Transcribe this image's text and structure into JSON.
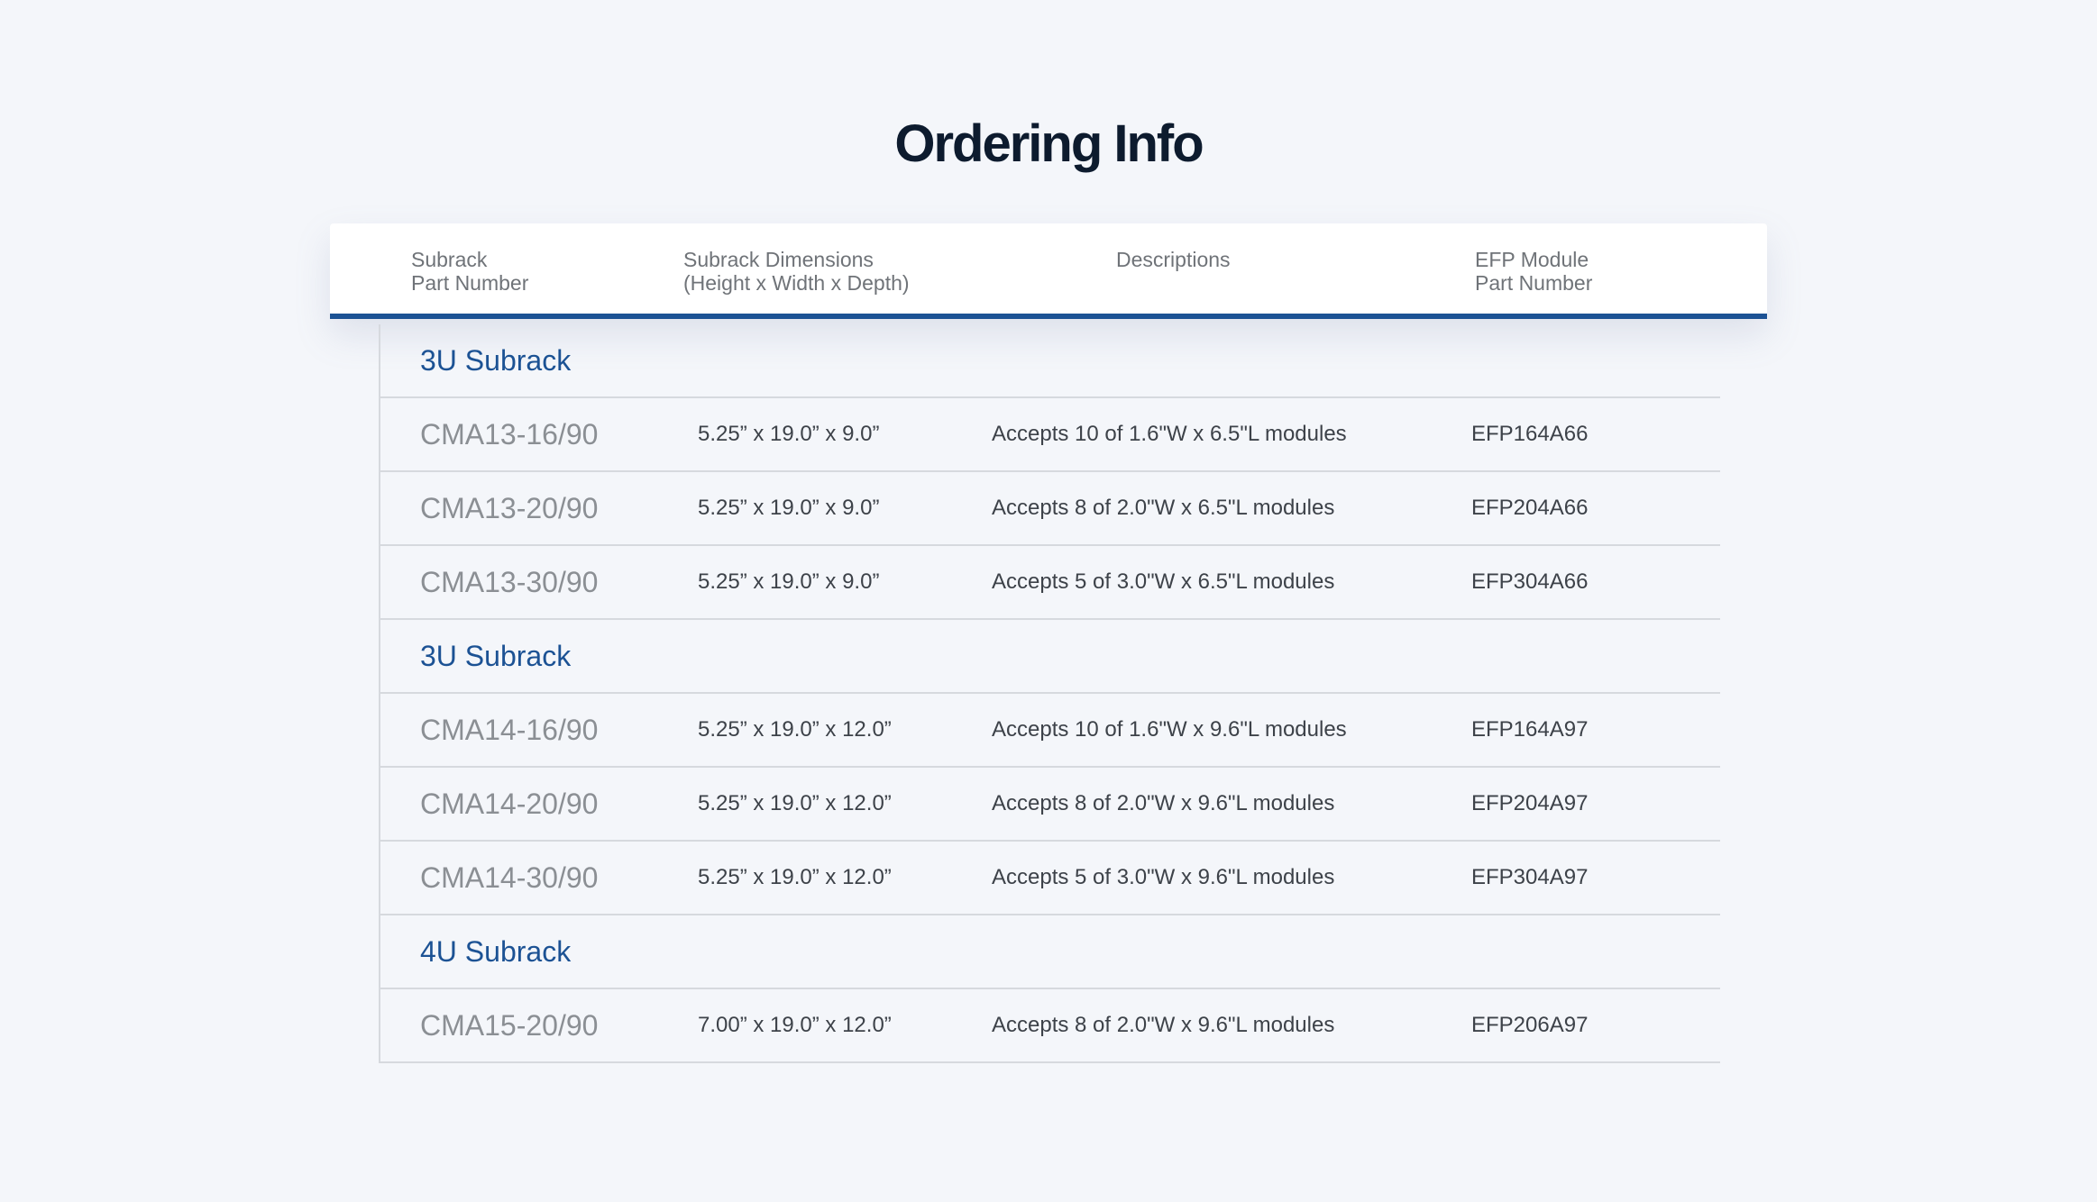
{
  "page": {
    "title": "Ordering Info"
  },
  "table": {
    "headers": {
      "part_line1": "Subrack",
      "part_line2": "Part Number",
      "dim_line1": "Subrack Dimensions",
      "dim_line2": "(Height x Width x Depth)",
      "desc": "Descriptions",
      "efp_line1": "EFP Module",
      "efp_line2": "Part Number"
    },
    "rows": [
      {
        "type": "group",
        "label": "3U Subrack"
      },
      {
        "type": "data",
        "part": "CMA13-16/90",
        "dim": "5.25” x 19.0” x 9.0”",
        "desc": "Accepts 10 of 1.6\"W x 6.5\"L modules",
        "efp": "EFP164A66"
      },
      {
        "type": "data",
        "part": "CMA13-20/90",
        "dim": "5.25” x 19.0” x 9.0”",
        "desc": "Accepts 8 of 2.0\"W x 6.5\"L modules",
        "efp": "EFP204A66"
      },
      {
        "type": "data",
        "part": "CMA13-30/90",
        "dim": "5.25” x 19.0” x 9.0”",
        "desc": "Accepts 5 of 3.0\"W x 6.5\"L modules",
        "efp": "EFP304A66"
      },
      {
        "type": "group",
        "label": "3U Subrack"
      },
      {
        "type": "data",
        "part": "CMA14-16/90",
        "dim": "5.25” x 19.0” x 12.0”",
        "desc": "Accepts 10 of 1.6\"W x 9.6\"L modules",
        "efp": "EFP164A97"
      },
      {
        "type": "data",
        "part": "CMA14-20/90",
        "dim": "5.25” x 19.0” x 12.0”",
        "desc": "Accepts 8 of 2.0\"W x 9.6\"L modules",
        "efp": "EFP204A97"
      },
      {
        "type": "data",
        "part": "CMA14-30/90",
        "dim": "5.25” x 19.0” x 12.0”",
        "desc": "Accepts 5 of 3.0\"W x 9.6\"L modules",
        "efp": "EFP304A97"
      },
      {
        "type": "group",
        "label": "4U Subrack"
      },
      {
        "type": "data",
        "part": "CMA15-20/90",
        "dim": "7.00” x 19.0” x 12.0”",
        "desc": "Accepts 8 of 2.0\"W x 9.6\"L modules",
        "efp": "EFP206A97"
      }
    ]
  },
  "colors": {
    "accent": "#1c5294",
    "background": "#f4f6fa",
    "title": "#0d1b2e"
  }
}
